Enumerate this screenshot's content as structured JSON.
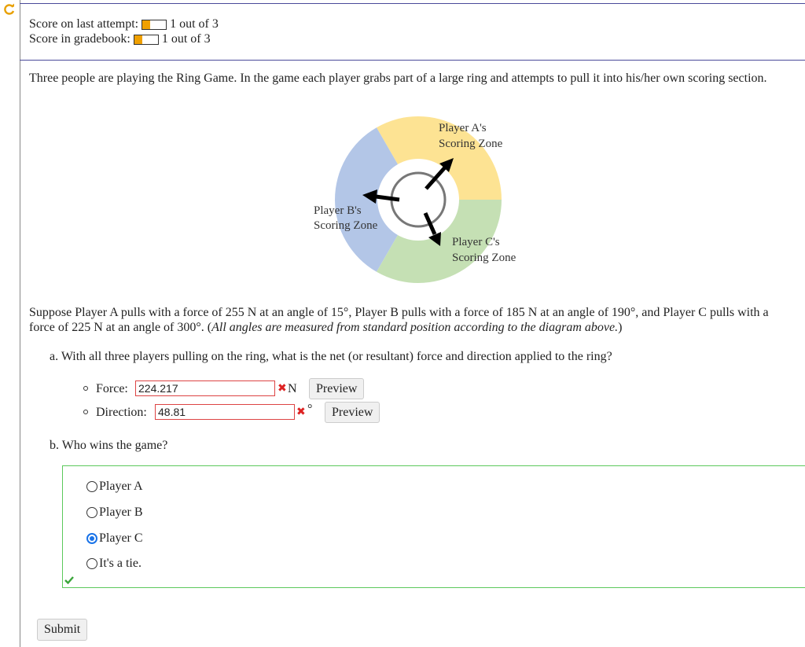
{
  "score": {
    "last_label": "Score on last attempt:",
    "last_value": "1 out of 3",
    "last_fraction": 0.333,
    "gradebook_label": "Score in gradebook:",
    "gradebook_value": "1 out of 3",
    "gradebook_fraction": 0.333
  },
  "question": {
    "intro": "Three people are playing the Ring Game. In the game each player grabs part of a large ring and attempts to pull it into his/her own scoring section.",
    "diagram": {
      "zone_a_line1": "Player A's",
      "zone_a_line2": "Scoring Zone",
      "zone_b_line1": "Player B's",
      "zone_b_line2": "Scoring Zone",
      "zone_c_line1": "Player C's",
      "zone_c_line2": "Scoring Zone",
      "colors": {
        "zone_a": "#fde393",
        "zone_b": "#b3c6e7",
        "zone_c": "#c5e0b4"
      }
    },
    "setup_plain": "Suppose Player A pulls with a force of 255 N at an angle of 15°, Player B pulls with a force of 185 N at an angle of 190°, and Player C pulls with a force of 225 N at an angle of 300°. (",
    "setup_italic": "All angles are measured from standard position according to the diagram above.",
    "setup_close": ")",
    "part_a": "a. With all three players pulling on the ring, what is the net (or resultant) force and direction applied to the ring?",
    "force_label": "Force:",
    "force_value": "224.217",
    "force_unit": "N",
    "direction_label": "Direction:",
    "direction_value": "48.81",
    "direction_unit": "°",
    "preview_label": "Preview",
    "part_b": "b. Who wins the game?",
    "options": [
      "Player A",
      "Player B",
      "Player C",
      "It's a tie."
    ],
    "selected_option": "Player C",
    "submit_label": "Submit"
  }
}
